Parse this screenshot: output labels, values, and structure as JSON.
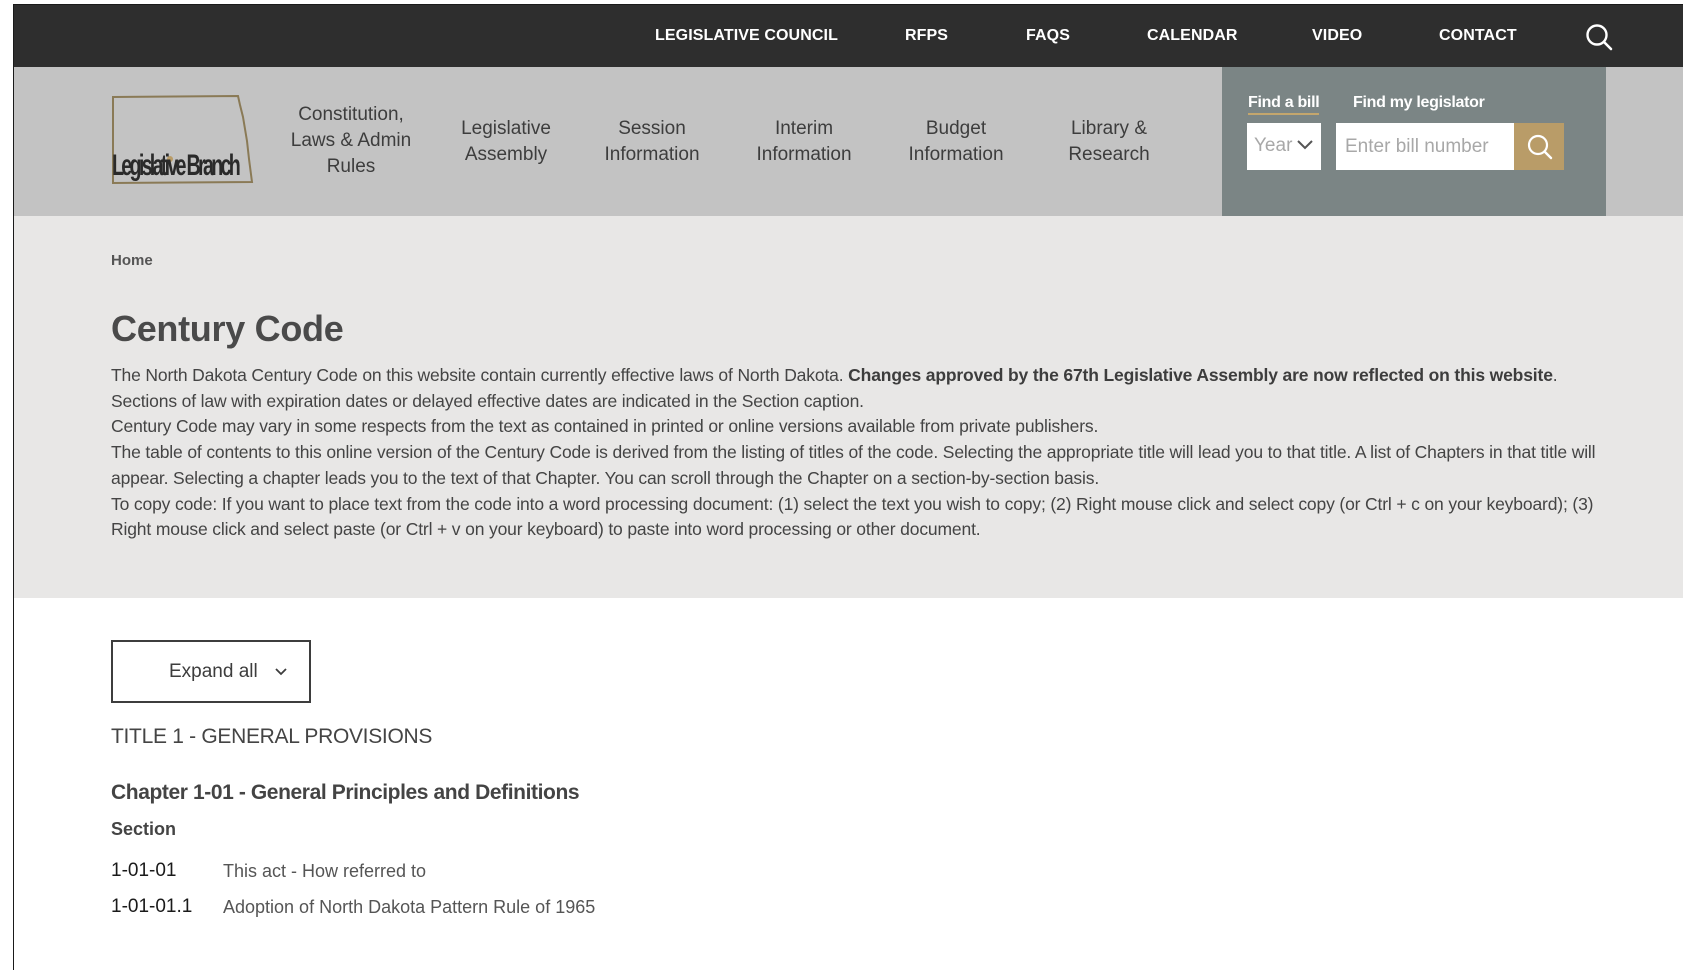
{
  "topbar": {
    "links": [
      "LEGISLATIVE COUNCIL",
      "RFPS",
      "FAQS",
      "CALENDAR",
      "VIDEO",
      "CONTACT"
    ]
  },
  "nav": {
    "logo_text": "Legislative Branch",
    "items": [
      {
        "line1": "Constitution,",
        "line2": "Laws & Admin",
        "line3": "Rules"
      },
      {
        "line1": "Legislative",
        "line2": "Assembly"
      },
      {
        "line1": "Session",
        "line2": "Information"
      },
      {
        "line1": "Interim",
        "line2": "Information"
      },
      {
        "line1": "Budget",
        "line2": "Information"
      },
      {
        "line1": "Library &",
        "line2": "Research"
      }
    ]
  },
  "finder": {
    "tab_bill": "Find a bill",
    "tab_legislator": "Find my legislator",
    "year_value": "Year",
    "bill_placeholder": "Enter bill number"
  },
  "colors": {
    "topbar": "#2e2e2e",
    "nav_bg": "#c3c3c3",
    "finder_bg": "#7b8585",
    "accent_gold": "#b99c68",
    "intro_bg": "#e8e7e6"
  },
  "breadcrumb": "Home",
  "page_title": "Century Code",
  "intro": {
    "p1_a": "The North Dakota Century Code on this website contain currently effective laws of North Dakota. ",
    "p1_bold": "Changes approved by the 67th Legislative Assembly are now reflected on this website",
    "p1_b": ". Sections of law with expiration dates or delayed effective dates are indicated in the Section caption.",
    "p2": "Century Code may vary in some respects from the text as contained in printed or online versions available from private publishers.",
    "p3": "The table of contents to this online version of the Century Code is derived from the listing of titles of the code. Selecting the appropriate title will lead you to that title. A list of Chapters in that title will appear. Selecting a chapter leads you to the text of that Chapter. You can scroll through the Chapter on a section-by-section basis.",
    "p4": "To copy code: If you want to place text from the code into a word processing document: (1) select the text you wish to copy; (2) Right mouse click and select copy (or Ctrl + c on your keyboard); (3) Right mouse click and select paste (or Ctrl + v on your keyboard) to paste into word processing or other document."
  },
  "content": {
    "expand_label": "Expand all",
    "title_heading": "TITLE 1 - GENERAL PROVISIONS",
    "chapter_heading": "Chapter 1-01 - General Principles and Definitions",
    "section_label": "Section",
    "sections": [
      {
        "num": "1-01-01",
        "desc": "This act - How referred to"
      },
      {
        "num": "1-01-01.1",
        "desc": "Adoption of North Dakota Pattern Rule of 1965"
      }
    ]
  },
  "icons": {
    "search": "search-icon",
    "chevron": "chevron-down-icon"
  }
}
